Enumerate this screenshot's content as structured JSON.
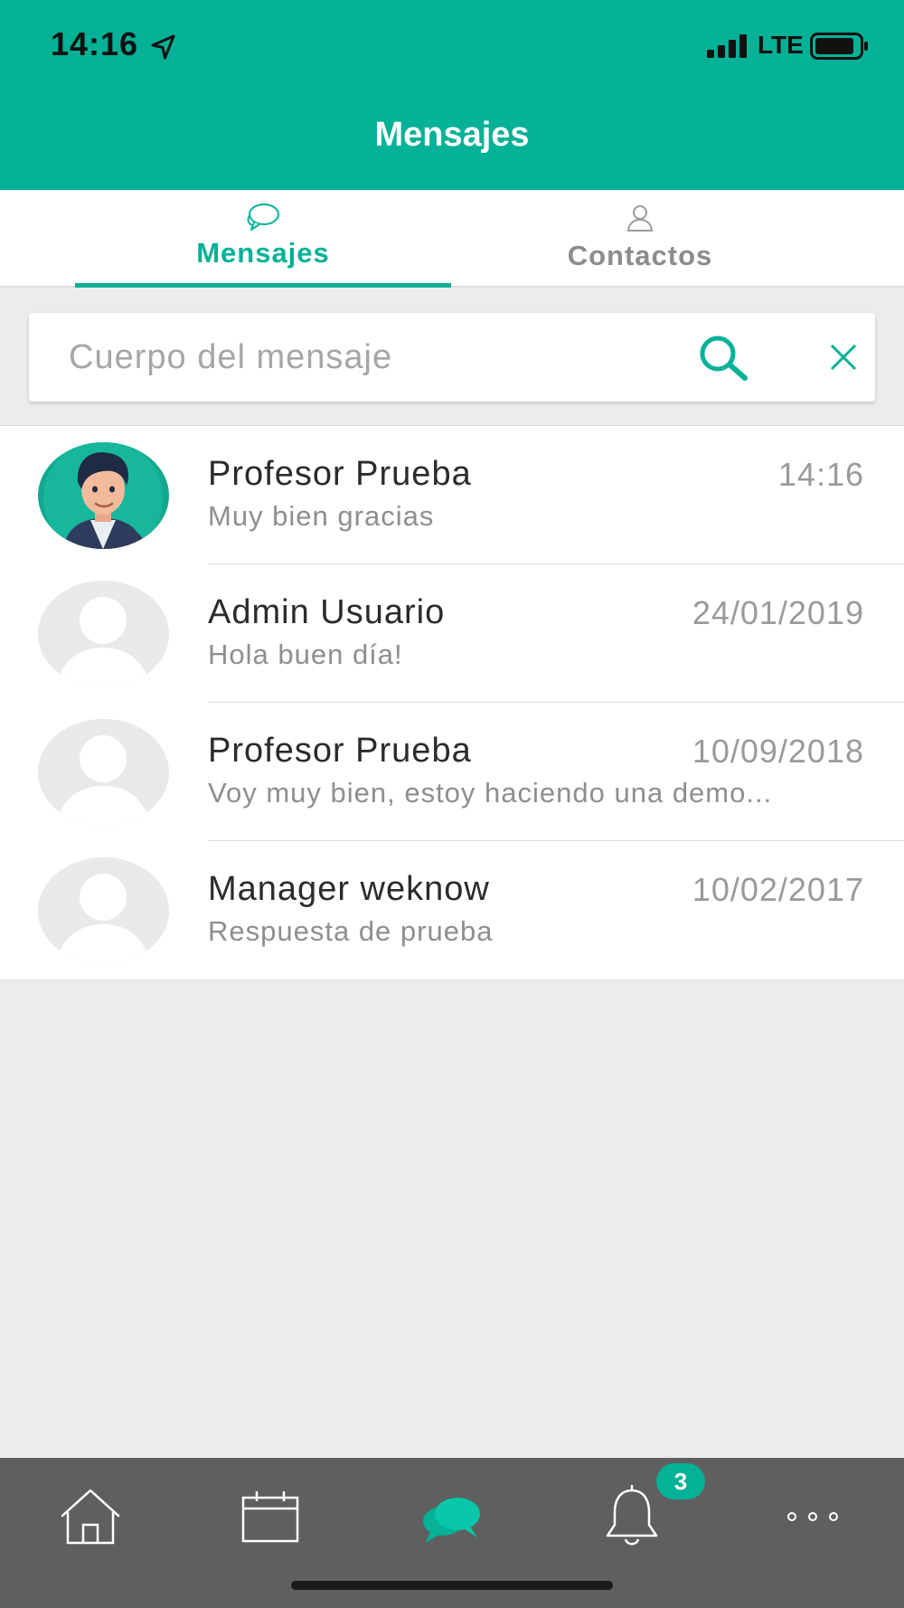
{
  "status_bar": {
    "time": "14:16",
    "network": "LTE",
    "icons": [
      "location-arrow-icon",
      "signal-bars-icon",
      "battery-icon"
    ]
  },
  "header": {
    "title": "Mensajes"
  },
  "tabs": [
    {
      "label": "Mensajes",
      "icon": "chat-bubbles-icon",
      "active": true
    },
    {
      "label": "Contactos",
      "icon": "person-icon",
      "active": false
    }
  ],
  "search": {
    "value": "",
    "placeholder": "Cuerpo del mensaje",
    "icons": [
      "search-icon",
      "close-icon"
    ]
  },
  "conversations": [
    {
      "name": "Profesor Prueba",
      "date": "14:16",
      "preview": "Muy bien gracias",
      "avatar": "illustrated-avatar"
    },
    {
      "name": "Admin Usuario",
      "date": "24/01/2019",
      "preview": "Hola buen día!",
      "avatar": "placeholder-avatar"
    },
    {
      "name": "Profesor Prueba",
      "date": "10/09/2018",
      "preview": "Voy muy bien, estoy haciendo una demo...",
      "avatar": "placeholder-avatar"
    },
    {
      "name": "Manager weknow",
      "date": "10/02/2017",
      "preview": "Respuesta de prueba",
      "avatar": "placeholder-avatar"
    }
  ],
  "bottom_nav": {
    "items": [
      "home-icon",
      "calendar-icon",
      "chat-bubbles-icon",
      "bell-icon",
      "more-icon"
    ],
    "active": "chat-bubbles-icon",
    "notifications_badge": "3"
  },
  "colors": {
    "accent": "#05b197",
    "nav_background": "#5f5f5f",
    "page_background": "#ececec"
  }
}
